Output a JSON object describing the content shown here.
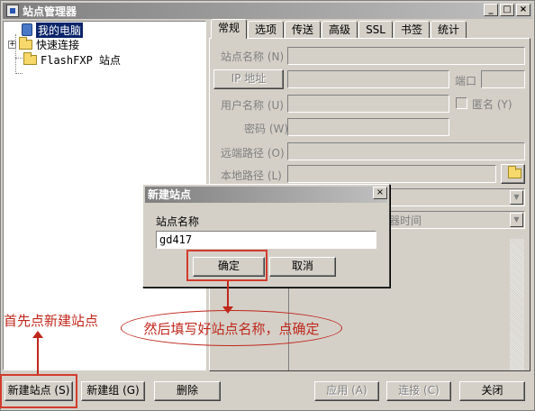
{
  "window": {
    "title": "站点管理器",
    "controls": {
      "minimize": "_",
      "maximize": "□",
      "close": "×"
    }
  },
  "tree": {
    "items": [
      {
        "label": "我的电脑",
        "icon": "computer-icon",
        "selected": true
      },
      {
        "label": "快速连接",
        "icon": "folder-icon",
        "expandable": true
      },
      {
        "label": "FlashFXP 站点",
        "icon": "folder-icon"
      }
    ],
    "expander": "+"
  },
  "tabs": [
    "常规",
    "选项",
    "传送",
    "高级",
    "SSL",
    "书签",
    "统计"
  ],
  "form": {
    "site_name_label": "站点名称 (N)",
    "ip_button": "IP 地址",
    "port_label": "端口",
    "username_label": "用户名称 (U)",
    "anonymous_label": "匿名 (Y)",
    "password_label": "密码 (W)",
    "remote_path_label": "远端路径 (O)",
    "local_path_label": "本地路径 (L)",
    "server_time_label": "器时间",
    "browse_icon": "folder-open-icon"
  },
  "dialog": {
    "title": "新建站点",
    "close": "×",
    "field_label": "站点名称",
    "field_value": "gd417",
    "ok_label": "确定",
    "cancel_label": "取消"
  },
  "buttons": {
    "new_site": "新建站点 (S)",
    "new_group": "新建组 (G)",
    "delete": "删除",
    "apply": "应用 (A)",
    "connect": "连接 (C)",
    "close": "关闭"
  },
  "annotations": {
    "step1": "首先点新建站点",
    "step2": "然后填写好站点名称，点确定",
    "color": "#c0271b"
  }
}
